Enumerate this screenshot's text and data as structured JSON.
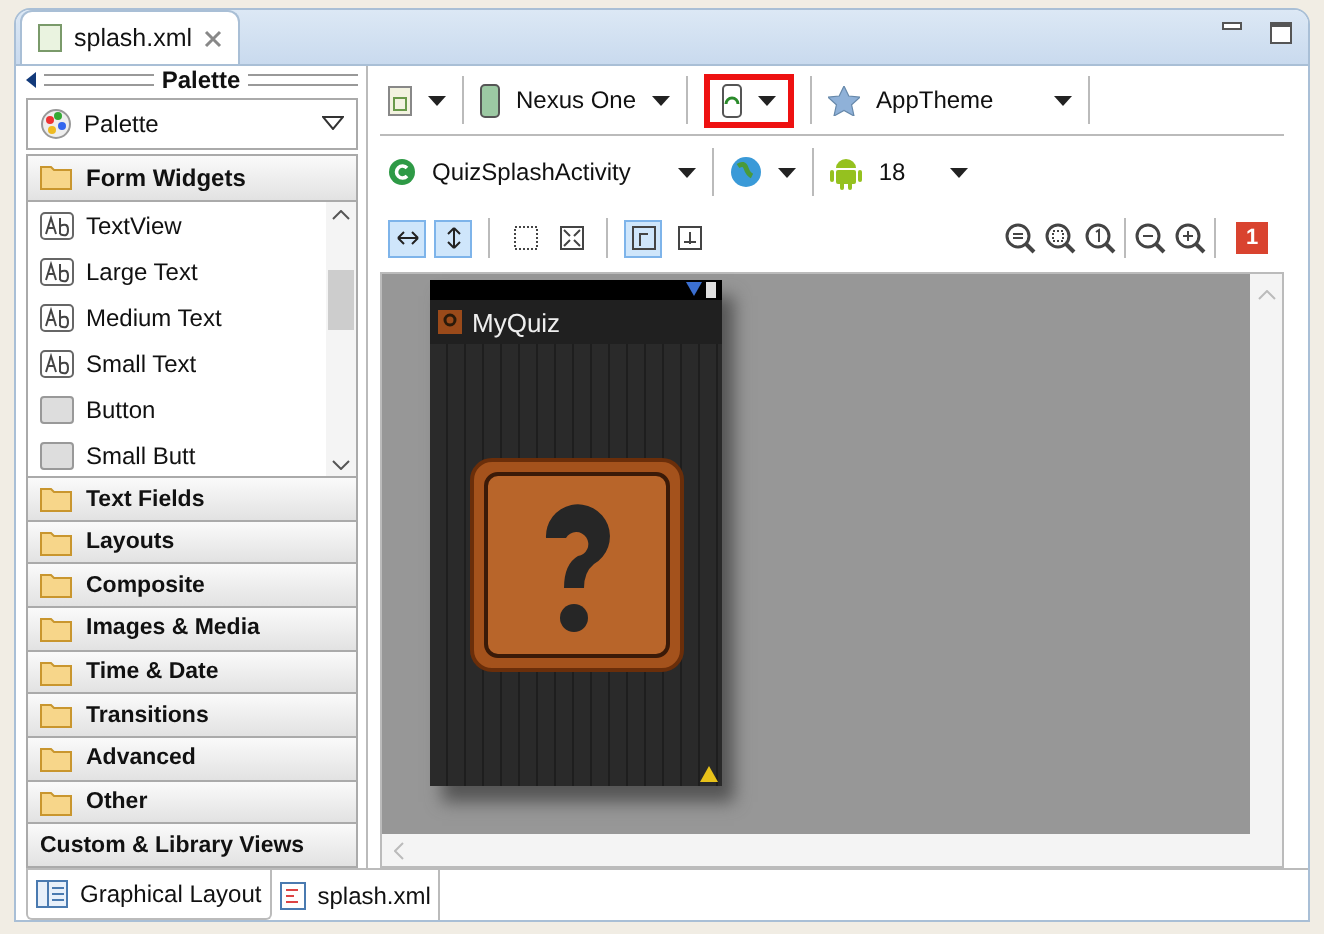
{
  "editor_tab": {
    "title": "splash.xml"
  },
  "palette": {
    "title": "Palette",
    "dropdown": "Palette",
    "open_category": "Form Widgets",
    "items": [
      {
        "label": "TextView",
        "kind": "text"
      },
      {
        "label": "Large Text",
        "kind": "text"
      },
      {
        "label": "Medium Text",
        "kind": "text"
      },
      {
        "label": "Small Text",
        "kind": "text"
      },
      {
        "label": "Button",
        "kind": "button"
      },
      {
        "label": "Small Butt",
        "kind": "button"
      }
    ],
    "categories": [
      "Text Fields",
      "Layouts",
      "Composite",
      "Images & Media",
      "Time & Date",
      "Transitions",
      "Advanced",
      "Other"
    ],
    "footer": "Custom & Library Views"
  },
  "toolbar": {
    "device": "Nexus One",
    "theme": "AppTheme",
    "activity": "QuizSplashActivity",
    "api": "18",
    "error_count": "1"
  },
  "layout_toggles": [
    {
      "kind": "fill-width",
      "selected": true
    },
    {
      "kind": "fill-height",
      "selected": true
    },
    {
      "kind": "margins",
      "selected": false
    },
    {
      "kind": "fit",
      "selected": false
    },
    {
      "kind": "wrap",
      "selected": true
    },
    {
      "kind": "match",
      "selected": false
    }
  ],
  "phone": {
    "app_title": "MyQuiz"
  },
  "bottom_tabs": [
    {
      "label": "Graphical Layout",
      "selected": true
    },
    {
      "label": "splash.xml",
      "selected": false
    }
  ]
}
